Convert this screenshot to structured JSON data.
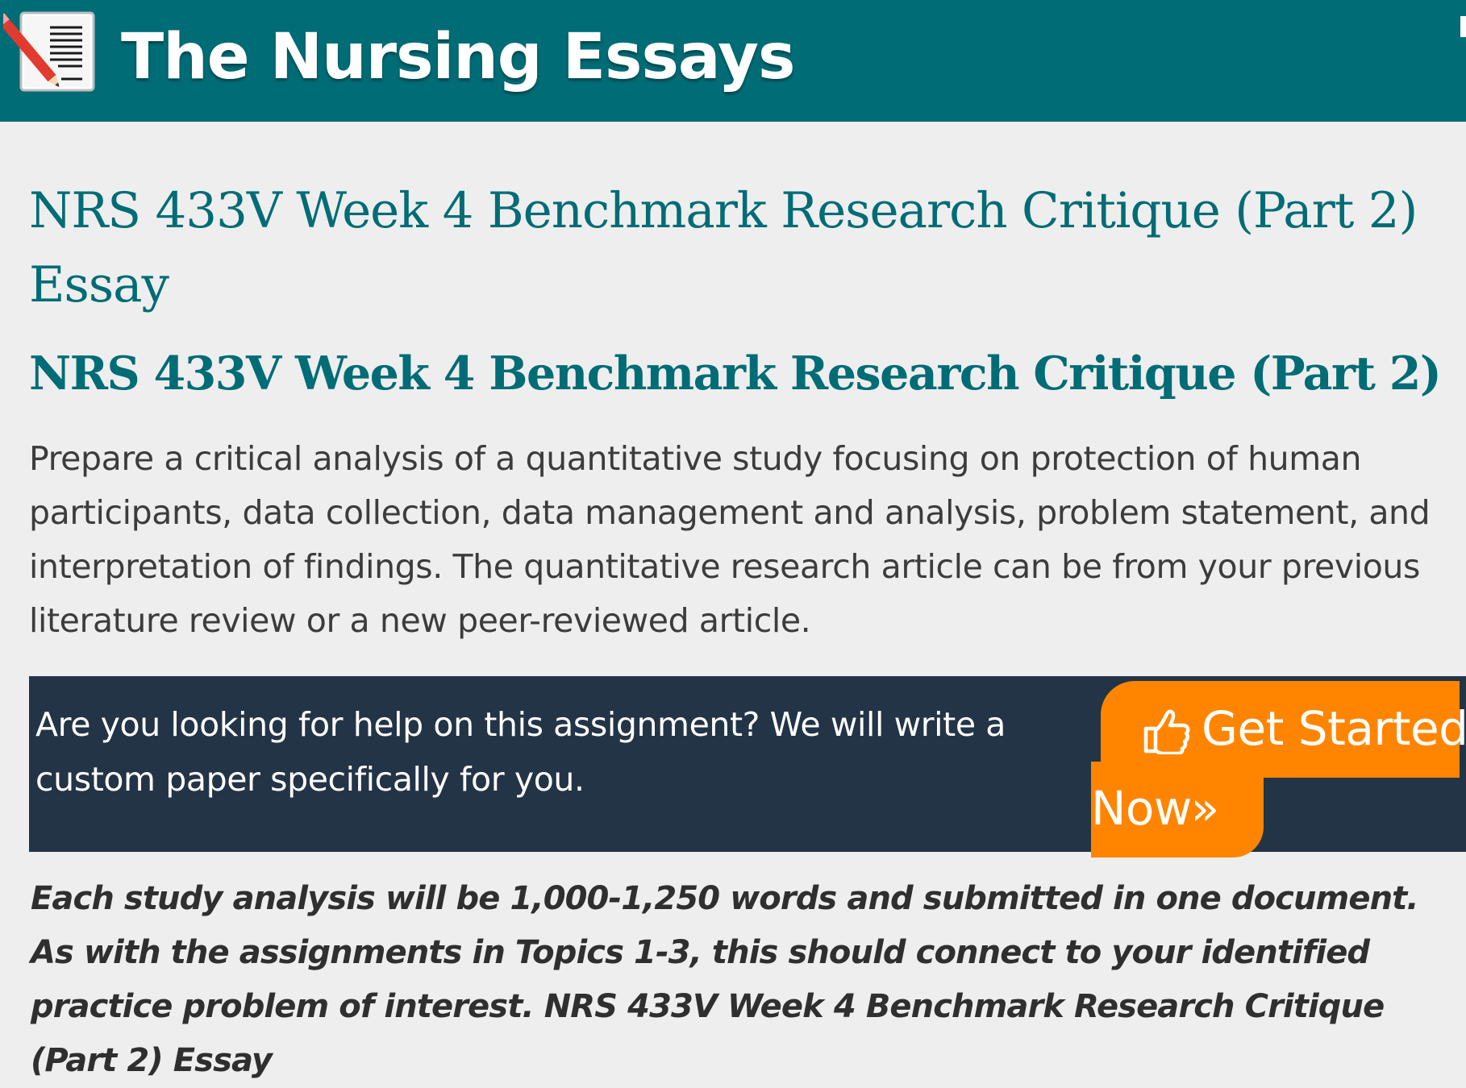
{
  "header": {
    "logo_icon": "notepad-pencil-icon",
    "site_name": "The Nursing Essays",
    "background_color": "#006c76"
  },
  "article": {
    "title": "NRS 433V Week 4 Benchmark Research Critique (Part 2) Essay",
    "heading": "NRS 433V Week 4 Benchmark Research Critique (Part 2)",
    "intro": "Prepare a critical analysis of a quantitative study focusing on protection of human participants, data collection, data management and analysis, problem statement, and interpretation of findings. The quantitative research article can be from your previous literature review or a new peer-reviewed article.",
    "emphasis": "Each study analysis will be 1,000-1,250 words and submitted in one document. As with the assignments in Topics 1-3, this should connect to your identified practice problem of interest. NRS 433V Week 4 Benchmark Research Critique (Part 2) Essay"
  },
  "cta": {
    "text": "Are you looking for help on this assignment? We will write a custom paper specifically for you.",
    "button_icon": "thumbs-up-pointing-icon",
    "button_line1": "Get Started",
    "button_line2": "Now»",
    "box_color": "#233447",
    "button_color": "#ff8500"
  },
  "colors": {
    "accent": "#006c76",
    "page_background": "#eeeeee"
  }
}
